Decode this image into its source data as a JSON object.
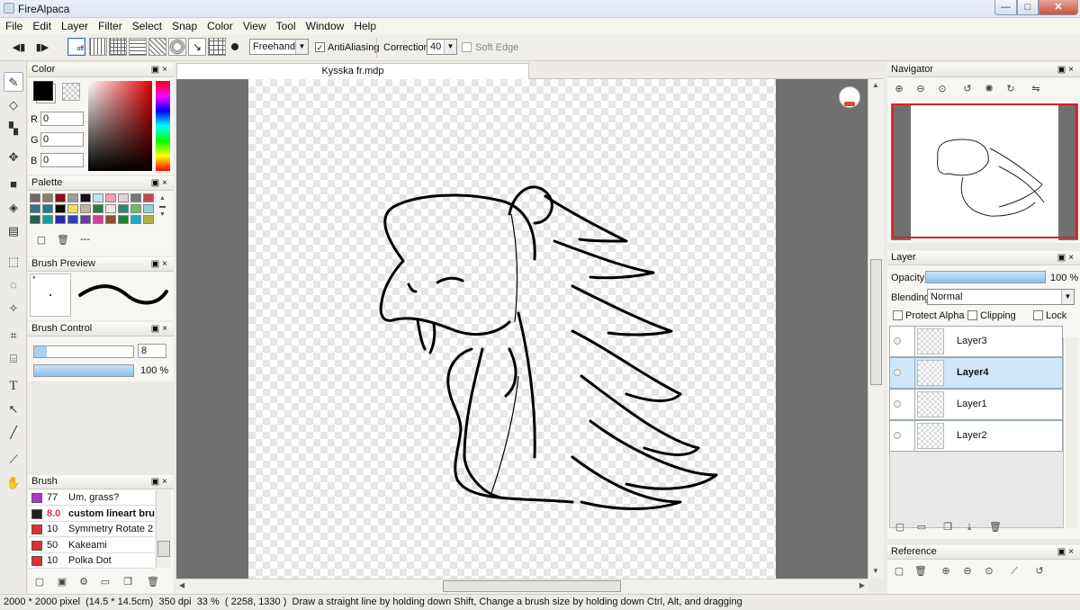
{
  "window": {
    "title": "FireAlpaca",
    "min": "—",
    "max": "□",
    "close": "✕"
  },
  "menu": [
    "File",
    "Edit",
    "Layer",
    "Filter",
    "Select",
    "Snap",
    "Color",
    "View",
    "Tool",
    "Window",
    "Help"
  ],
  "toolbar": {
    "prev": "◀▮",
    "next": "▮▶",
    "snap_off_label": "off",
    "brush_mode": "Freehand",
    "antialiasing_label": "AntiAliasing",
    "antialiasing": true,
    "correction_label": "Correction",
    "correction_value": "40",
    "soft_edge_label": "Soft Edge",
    "soft_edge": false
  },
  "color_panel": {
    "title": "Color",
    "r_label": "R",
    "r": "0",
    "g_label": "G",
    "g": "0",
    "b_label": "B",
    "b": "0",
    "primary": "#000000"
  },
  "palette_panel": {
    "title": "Palette",
    "swatches": [
      "#706868",
      "#8c7b6b",
      "#8b0f1e",
      "#9c9c9c",
      "#111111",
      "#bfe6f0",
      "#f0a0b8",
      "#e8d0d8",
      "#777777",
      "#c44a4a",
      "#3a6f8a",
      "#1a7a9a",
      "#101010",
      "#f0e060",
      "#c8b0a0",
      "#208040",
      "#e8e8e8",
      "#2a8a70",
      "#70c060",
      "#90d0e0",
      "#206050",
      "#10a0a0",
      "#2030a0",
      "#3040b0",
      "#6040a0",
      "#d040a0",
      "#8a5030",
      "#208030",
      "#10b0c0",
      "#b0b040"
    ],
    "dots": "---"
  },
  "brush_preview_panel": {
    "title": "Brush Preview",
    "dot": "*"
  },
  "brush_control_panel": {
    "title": "Brush Control",
    "size": "8",
    "opacity": "100 %",
    "opacity_value": 1.0
  },
  "brush_panel": {
    "title": "Brush",
    "items": [
      {
        "size": "77",
        "name": "Um, grass?",
        "color": "#b030d0",
        "selected": false
      },
      {
        "size": "8.0",
        "name": "custom lineart brush",
        "color": "#222222",
        "selected": true
      },
      {
        "size": "10",
        "name": "Symmetry Rotate 2",
        "color": "#e03030",
        "selected": false
      },
      {
        "size": "50",
        "name": "Kakeami",
        "color": "#e03030",
        "selected": false
      },
      {
        "size": "10",
        "name": "Polka Dot",
        "color": "#e03030",
        "selected": false
      }
    ]
  },
  "document": {
    "tab": "Kysska fr.mdp"
  },
  "navigator_panel": {
    "title": "Navigator"
  },
  "layer_panel": {
    "title": "Layer",
    "opacity_label": "Opacity",
    "opacity": "100 %",
    "opacity_value": 1.0,
    "blending_label": "Blending",
    "blending": "Normal",
    "protect_alpha": "Protect Alpha",
    "clipping": "Clipping",
    "lock": "Lock",
    "layers": [
      {
        "name": "Layer3",
        "selected": false
      },
      {
        "name": "Layer4",
        "selected": true
      },
      {
        "name": "Layer1",
        "selected": false
      },
      {
        "name": "Layer2",
        "selected": false
      }
    ]
  },
  "reference_panel": {
    "title": "Reference"
  },
  "status": {
    "size": "2000 * 2000 pixel",
    "cm": "(14.5 * 14.5cm)",
    "dpi": "350 dpi",
    "zoom": "33 %",
    "coords": "( 2258, 1330 )",
    "hint": "Draw a straight line by holding down Shift, Change a brush size by holding down Ctrl, Alt, and dragging"
  },
  "colors": {
    "accent": "#9cc8f0",
    "selection": "#cfe6fb",
    "nav_frame": "#e02020"
  }
}
